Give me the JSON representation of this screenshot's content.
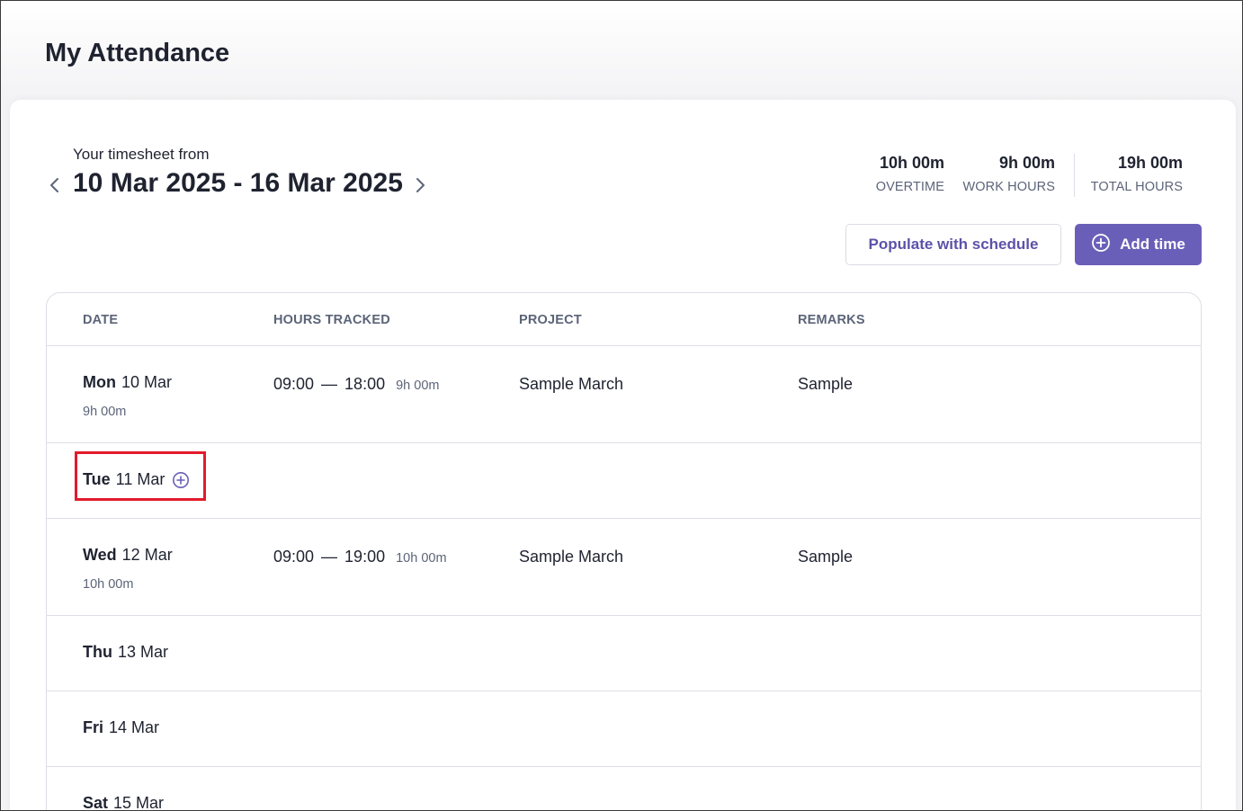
{
  "page": {
    "title": "My Attendance"
  },
  "timesheet": {
    "from_label": "Your timesheet from",
    "range": "10 Mar 2025 - 16 Mar 2025"
  },
  "stats": [
    {
      "value": "10h 00m",
      "label": "OVERTIME"
    },
    {
      "value": "9h 00m",
      "label": "WORK HOURS"
    },
    {
      "value": "19h 00m",
      "label": "TOTAL HOURS"
    }
  ],
  "actions": {
    "populate_label": "Populate with schedule",
    "add_time_label": "Add time"
  },
  "table": {
    "headers": {
      "date": "DATE",
      "hours": "HOURS TRACKED",
      "project": "PROJECT",
      "remarks": "REMARKS"
    },
    "rows": [
      {
        "day": "Mon",
        "date": "10 Mar",
        "total": "9h 00m",
        "start": "09:00",
        "dash": "—",
        "end": "18:00",
        "duration": "9h 00m",
        "project": "Sample March",
        "remarks": "Sample"
      },
      {
        "day": "Tue",
        "date": "11 Mar"
      },
      {
        "day": "Wed",
        "date": "12 Mar",
        "total": "10h 00m",
        "start": "09:00",
        "dash": "—",
        "end": "19:00",
        "duration": "10h 00m",
        "project": "Sample March",
        "remarks": "Sample"
      },
      {
        "day": "Thu",
        "date": "13 Mar"
      },
      {
        "day": "Fri",
        "date": "14 Mar"
      },
      {
        "day": "Sat",
        "date": "15 Mar"
      }
    ]
  },
  "colors": {
    "accent": "#6a5fb8",
    "highlight": "#e21b2b",
    "muted": "#5b6478"
  },
  "icons": {
    "prev": "chevron-left-icon",
    "next": "chevron-right-icon",
    "add": "plus-circle-icon"
  }
}
